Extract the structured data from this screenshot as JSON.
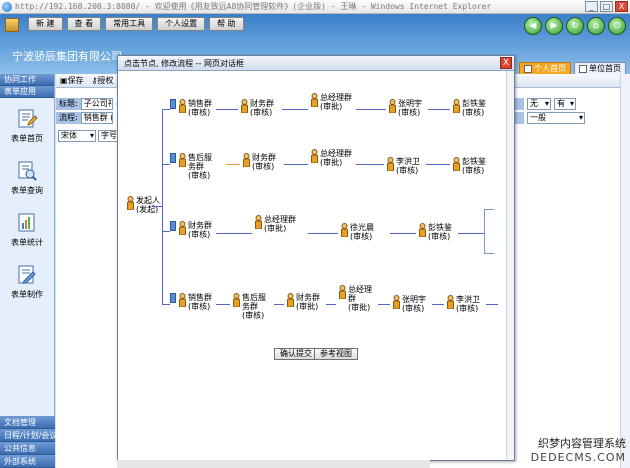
{
  "window": {
    "title": "http://192.168.200.3:8080/ - 欢迎使用《用友致远A8协同管理软件》(企业版) - 王琳 - Windows Internet Explorer",
    "controls": [
      "_",
      "□",
      "X"
    ]
  },
  "topmenu": {
    "items": [
      "新 建",
      "查 看",
      "常用工具",
      "个人设置",
      "帮 助"
    ]
  },
  "company": "宁波骄辰集团有限公司",
  "tabs_right": [
    "个人首页",
    "单位首页"
  ],
  "sidebar": {
    "top_headers": [
      "协同工作",
      "表单应用"
    ],
    "items": [
      "表单首页",
      "表单查询",
      "表单统计",
      "表单制作"
    ],
    "bottom_headers": [
      "文档管理",
      "日程/计划/会议",
      "公共信息",
      "外部系统"
    ]
  },
  "content": {
    "toolbar": {
      "save": "保存",
      "auth": "授权"
    },
    "row1": {
      "label": "标题:",
      "value": "子公司礼",
      "sel1": "无",
      "sel2": "有"
    },
    "row2": {
      "label": "流程:",
      "value": "销售群 (",
      "sel3": "一般"
    },
    "row3": {
      "font": "宋体",
      "size": "字号"
    }
  },
  "modal": {
    "title": "点击节点, 修改流程 -- 网页对话框",
    "close": "X",
    "initiator": {
      "name": "发起人",
      "role": "(发起)"
    },
    "rows": [
      [
        {
          "name": "销售群",
          "role": "(审核)"
        },
        {
          "name": "财务群",
          "role": "(审核)"
        },
        {
          "name": "总经理群",
          "role": "(审批)"
        },
        {
          "name": "张明宇",
          "role": "(审核)"
        },
        {
          "name": "彭铁鉴",
          "role": "(审核)"
        }
      ],
      [
        {
          "name": "售后服务群",
          "role": "(审核)"
        },
        {
          "name": "财务群",
          "role": "(审核)"
        },
        {
          "name": "总经理群",
          "role": "(审批)"
        },
        {
          "name": "李洪卫",
          "role": "(审核)"
        },
        {
          "name": "彭铁鉴",
          "role": "(审核)"
        }
      ],
      [
        {
          "name": "财务群",
          "role": "(审核)"
        },
        {
          "name": "总经理群",
          "role": "(审批)"
        },
        {
          "name": "徐光晨",
          "role": "(审核)"
        },
        {
          "name": "彭铁鉴",
          "role": "(审核)"
        }
      ],
      [
        {
          "name": "销售群",
          "role": "(审核)"
        },
        {
          "name": "售后服务群",
          "role": "(审核)"
        },
        {
          "name": "财务群",
          "role": "(审批)"
        },
        {
          "name": "总经理群",
          "role": "(审批)"
        },
        {
          "name": "张明宇",
          "role": "(审核)"
        },
        {
          "name": "李洪卫",
          "role": "(审核)"
        }
      ]
    ],
    "buttons": {
      "confirm": "确认提交",
      "reference": "参考视图"
    }
  },
  "watermark": {
    "line1": "织梦内容管理系统",
    "line2": "DEDECMS.COM"
  },
  "colors": {
    "accent": "#3b7fc9",
    "connector": "#5566cc",
    "active_tab": "#f5a623"
  },
  "icons": {
    "person": "person-icon",
    "node_marker": "node-marker-icon"
  }
}
